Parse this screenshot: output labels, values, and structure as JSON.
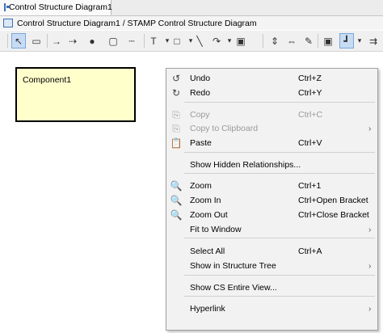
{
  "tab": {
    "label": "Control Structure Diagram1"
  },
  "path": {
    "label": "Control Structure Diagram1 / STAMP Control Structure Diagram"
  },
  "toolbar": {
    "tools": [
      {
        "name": "select-tool",
        "glyph": "↖"
      },
      {
        "name": "component-tool",
        "glyph": "▭"
      },
      {
        "name": "control-action-tool",
        "glyph": "→"
      },
      {
        "name": "feedback-tool",
        "glyph": "⇢"
      },
      {
        "name": "point-tool",
        "glyph": "●"
      },
      {
        "name": "note-tool",
        "glyph": "▢"
      },
      {
        "name": "dotted-line-tool",
        "glyph": "┄"
      },
      {
        "name": "text-tool",
        "glyph": "T"
      },
      {
        "name": "rectangle-tool",
        "glyph": "□"
      },
      {
        "name": "line-tool",
        "glyph": "╲"
      },
      {
        "name": "curve-tool",
        "glyph": "↷"
      },
      {
        "name": "image-tool",
        "glyph": "▣"
      },
      {
        "name": "vertical-spacing-tool",
        "glyph": "⇕"
      },
      {
        "name": "horizontal-spacing-tool",
        "glyph": "⇔"
      },
      {
        "name": "pin-tool",
        "glyph": "✎"
      },
      {
        "name": "frame-tool",
        "glyph": "▣"
      },
      {
        "name": "layout-tool",
        "glyph": "┛"
      },
      {
        "name": "routing-tool",
        "glyph": "⇉"
      }
    ]
  },
  "component": {
    "label": "Component1"
  },
  "menu": {
    "items": [
      {
        "label": "Undo",
        "shortcut": "Ctrl+Z",
        "icon": "undo-icon",
        "glyph": "↺",
        "enabled": true,
        "submenu": false
      },
      {
        "label": "Redo",
        "shortcut": "Ctrl+Y",
        "icon": "redo-icon",
        "glyph": "↻",
        "enabled": true,
        "submenu": false
      },
      {
        "label": "Copy",
        "shortcut": "Ctrl+C",
        "icon": "copy-icon",
        "glyph": "⎘",
        "enabled": false,
        "submenu": false
      },
      {
        "label": "Copy to Clipboard",
        "shortcut": "",
        "icon": "copy-clipboard-icon",
        "glyph": "⎘",
        "enabled": false,
        "submenu": true
      },
      {
        "label": "Paste",
        "shortcut": "Ctrl+V",
        "icon": "paste-icon",
        "glyph": "📋",
        "enabled": true,
        "submenu": false
      },
      {
        "label": "Show Hidden Relationships...",
        "shortcut": "",
        "icon": "",
        "glyph": "",
        "enabled": true,
        "submenu": false
      },
      {
        "label": "Zoom",
        "shortcut": "Ctrl+1",
        "icon": "zoom-icon",
        "glyph": "🔍",
        "enabled": true,
        "submenu": false
      },
      {
        "label": "Zoom In",
        "shortcut": "Ctrl+Open Bracket",
        "icon": "zoom-in-icon",
        "glyph": "🔍",
        "enabled": true,
        "submenu": false
      },
      {
        "label": "Zoom Out",
        "shortcut": "Ctrl+Close Bracket",
        "icon": "zoom-out-icon",
        "glyph": "🔍",
        "enabled": true,
        "submenu": false
      },
      {
        "label": "Fit to Window",
        "shortcut": "",
        "icon": "",
        "glyph": "",
        "enabled": true,
        "submenu": true
      },
      {
        "label": "Select All",
        "shortcut": "Ctrl+A",
        "icon": "",
        "glyph": "",
        "enabled": true,
        "submenu": false
      },
      {
        "label": "Show in Structure Tree",
        "shortcut": "",
        "icon": "",
        "glyph": "",
        "enabled": true,
        "submenu": true
      },
      {
        "label": "Show CS Entire View...",
        "shortcut": "",
        "icon": "",
        "glyph": "",
        "enabled": true,
        "submenu": false
      },
      {
        "label": "Hyperlink",
        "shortcut": "",
        "icon": "",
        "glyph": "",
        "enabled": true,
        "submenu": true
      }
    ]
  },
  "colors": {
    "component_fill": "#ffffcc",
    "menu_bg": "#f2f2f2",
    "selected_tool": "#c7dcf3"
  }
}
